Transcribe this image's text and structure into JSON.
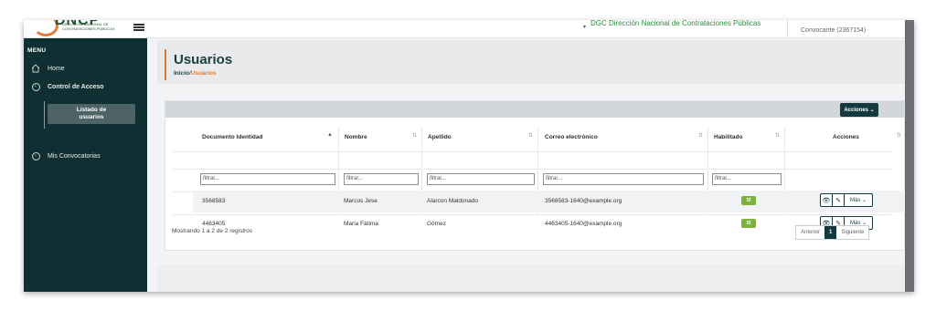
{
  "topbar": {
    "logo_text": "DNCP",
    "logo_sub1": "DIRECCIÓN NACIONAL DE",
    "logo_sub2": "CONTRATACIONES PÚBLICAS",
    "organization": "DGC Dirección Nacional de Contrataciones Públicas",
    "user_role": "Convocante (2367154)"
  },
  "sidebar": {
    "menu_title": "MENU",
    "items": [
      {
        "label": "Home",
        "icon": "home-icon"
      },
      {
        "label": "Control de Acceso",
        "icon": "chevron-circle-icon"
      },
      {
        "label": "Listado de usuarios",
        "line1": "Listado de",
        "line2": "usuarios"
      },
      {
        "label": "Mis Convocatorias",
        "icon": "chevron-circle-icon"
      }
    ]
  },
  "header": {
    "title": "Usuarios",
    "breadcrumb_home": "Inicio",
    "breadcrumb_sep": "/",
    "breadcrumb_current": "Usuarios"
  },
  "table": {
    "actions_label": "Acciones ⌄",
    "columns": [
      "Documento Identidad",
      "Nombre",
      "Apellido",
      "Correo electrónico",
      "Habilitado",
      "Acciones"
    ],
    "filter_placeholder": "filtrar...",
    "rows": [
      {
        "documento": "3568583",
        "nombre": "Marcos Jese",
        "apellido": "Alarcon Maldonado",
        "correo": "3568583-1640@example.org",
        "habilitado": "SÍ"
      },
      {
        "documento": "4463405",
        "nombre": "Maria Fátima",
        "apellido": "Gómez",
        "correo": "4463405-1640@example.org",
        "habilitado": "SÍ"
      }
    ],
    "more_label": "Más ⌄",
    "footer": "Mostrando 1 a 2 de 2 registros"
  },
  "pagination": {
    "prev": "Anterior",
    "current": "1",
    "next": "Siguiente"
  },
  "colors": {
    "sidebar_bg": "#0f2f33",
    "accent": "#e07a2f",
    "primary": "#12393d",
    "badge_green": "#7bb23b"
  }
}
